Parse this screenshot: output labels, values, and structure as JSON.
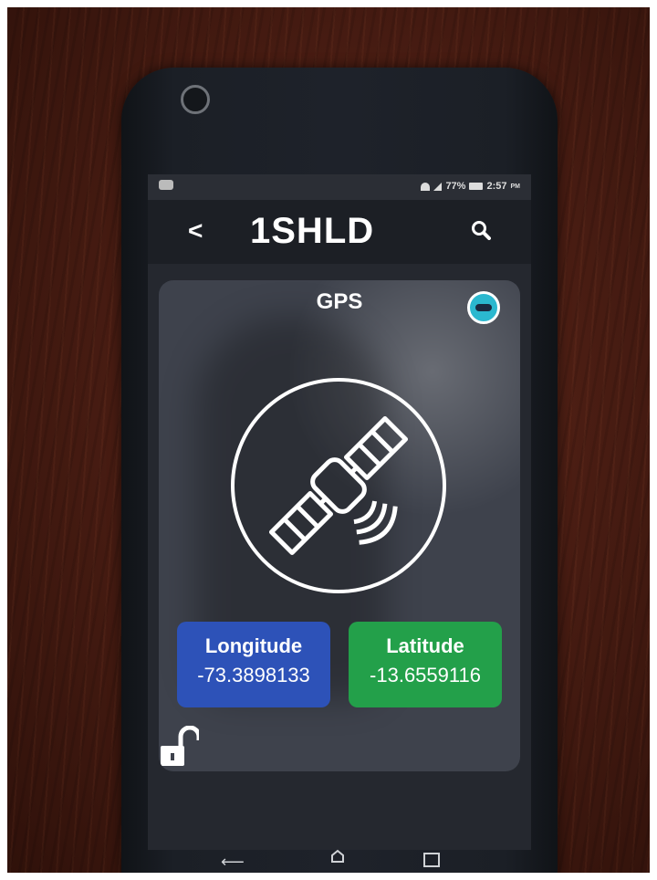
{
  "app": {
    "logo_text": "1SHLD",
    "back_symbol": "<",
    "colors": {
      "appbar": "#1c1f25",
      "card": "#3e424c",
      "toggle": "#2bb8cf"
    }
  },
  "status_bar": {
    "battery": "77%",
    "time": "2:57",
    "time_suffix": "PM"
  },
  "gps_panel": {
    "title": "GPS",
    "icon": "satellite-icon",
    "longitude": {
      "label": "Longitude",
      "value": "-73.3898133",
      "color": "#2d52b8"
    },
    "latitude": {
      "label": "Latitude",
      "value": "-13.6559116",
      "color": "#23a04a"
    }
  },
  "icons": [
    "back-icon",
    "search-icon",
    "toggle-icon",
    "satellite-icon",
    "unlock-icon",
    "nav-back-icon",
    "nav-home-icon",
    "nav-recent-icon"
  ]
}
